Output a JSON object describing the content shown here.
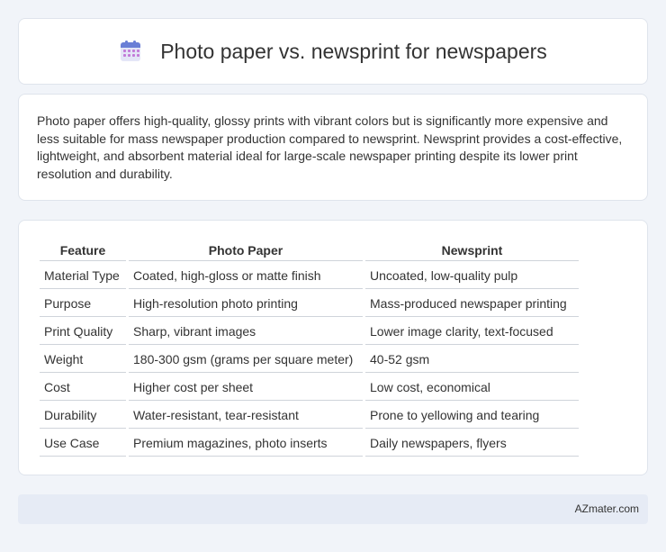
{
  "header": {
    "title": "Photo paper vs. newsprint for newspapers",
    "icon": "calendar-icon"
  },
  "description": "Photo paper offers high-quality, glossy prints with vibrant colors but is significantly more expensive and less suitable for mass newspaper production compared to newsprint. Newsprint provides a cost-effective, lightweight, and absorbent material ideal for large-scale newspaper printing despite its lower print resolution and durability.",
  "table": {
    "headers": [
      "Feature",
      "Photo Paper",
      "Newsprint"
    ],
    "rows": [
      [
        "Material Type",
        "Coated, high-gloss or matte finish",
        "Uncoated, low-quality pulp"
      ],
      [
        "Purpose",
        "High-resolution photo printing",
        "Mass-produced newspaper printing"
      ],
      [
        "Print Quality",
        "Sharp, vibrant images",
        "Lower image clarity, text-focused"
      ],
      [
        "Weight",
        "180-300 gsm (grams per square meter)",
        "40-52 gsm"
      ],
      [
        "Cost",
        "Higher cost per sheet",
        "Low cost, economical"
      ],
      [
        "Durability",
        "Water-resistant, tear-resistant",
        "Prone to yellowing and tearing"
      ],
      [
        "Use Case",
        "Premium magazines, photo inserts",
        "Daily newspapers, flyers"
      ]
    ]
  },
  "footer": {
    "brand": "AZmater.com"
  }
}
